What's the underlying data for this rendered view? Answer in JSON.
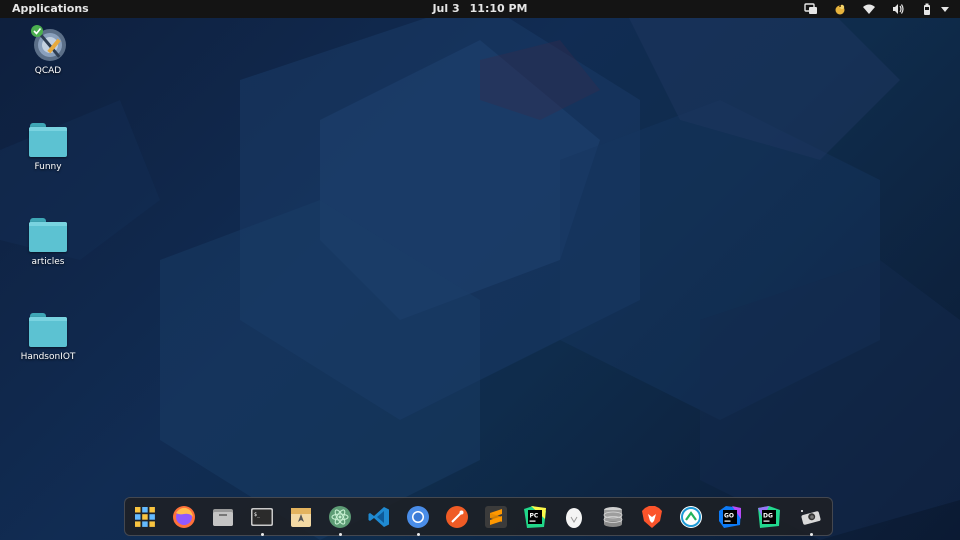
{
  "topbar": {
    "applications_label": "Applications",
    "date": "Jul 3",
    "time": "11:10 PM"
  },
  "tray_icons": [
    "screen-share-icon",
    "notification-bell-icon",
    "wifi-icon",
    "volume-icon",
    "battery-icon",
    "chevron-down-icon"
  ],
  "desktop": {
    "icons": [
      {
        "label": "QCAD",
        "icon": "qcad-app-icon"
      },
      {
        "label": "Funny",
        "icon": "folder-icon"
      },
      {
        "label": "articles",
        "icon": "folder-icon"
      },
      {
        "label": "HandsonIOT",
        "icon": "folder-icon"
      }
    ]
  },
  "dock": {
    "items": [
      {
        "icon": "app-grid-icon",
        "running": false
      },
      {
        "icon": "firefox-icon",
        "running": false
      },
      {
        "icon": "files-icon",
        "running": false
      },
      {
        "icon": "terminal-icon",
        "running": true
      },
      {
        "icon": "appcenter-icon",
        "running": false
      },
      {
        "icon": "atom-icon",
        "running": true
      },
      {
        "icon": "vscode-icon",
        "running": false
      },
      {
        "icon": "chromium-icon",
        "running": true
      },
      {
        "icon": "postman-icon",
        "running": false
      },
      {
        "icon": "sublime-text-icon",
        "running": false
      },
      {
        "icon": "pycharm-icon",
        "running": false
      },
      {
        "icon": "egg-icon",
        "running": false
      },
      {
        "icon": "database-icon",
        "running": false
      },
      {
        "icon": "brave-icon",
        "running": false
      },
      {
        "icon": "sync-app-icon",
        "running": false
      },
      {
        "icon": "goland-icon",
        "running": false
      },
      {
        "icon": "datagrip-icon",
        "running": false
      },
      {
        "icon": "screenshot-tool-icon",
        "running": true
      }
    ]
  }
}
